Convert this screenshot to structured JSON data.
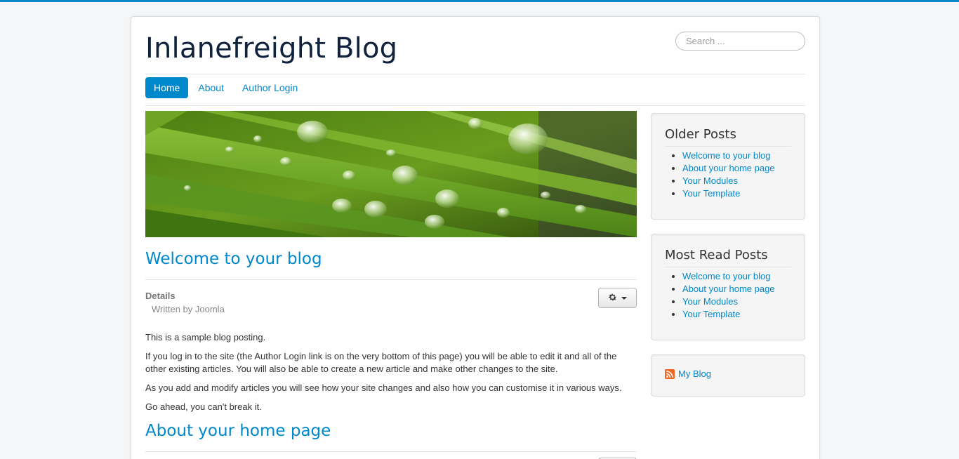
{
  "site": {
    "title": "Inlanefreight Blog",
    "search_placeholder": "Search ..."
  },
  "nav": {
    "items": [
      {
        "label": "Home",
        "active": true
      },
      {
        "label": "About",
        "active": false
      },
      {
        "label": "Author Login",
        "active": false
      }
    ]
  },
  "banner": {
    "icon": "dewdrop-grass-image"
  },
  "articles": [
    {
      "title": "Welcome to your blog",
      "details_label": "Details",
      "written_by": "Written by Joomla",
      "tools_icon": "gear-icon",
      "paragraphs": [
        "This is a sample blog posting.",
        "If you log in to the site (the Author Login link is on the very bottom of this page) you will be able to edit it and all of the other existing articles. You will also be able to create a new article and make other changes to the site.",
        "As you add and modify articles you will see how your site changes and also how you can customise it in various ways.",
        "Go ahead, you can't break it."
      ]
    },
    {
      "title": "About your home page"
    }
  ],
  "sidebar": {
    "older_posts": {
      "title": "Older Posts",
      "items": [
        "Welcome to your blog",
        "About your home page",
        "Your Modules",
        "Your Template"
      ]
    },
    "most_read": {
      "title": "Most Read Posts",
      "items": [
        "Welcome to your blog",
        "About your home page",
        "Your Modules",
        "Your Template"
      ]
    },
    "feed": {
      "label": "My Blog",
      "icon": "rss-icon"
    }
  },
  "colors": {
    "accent": "#0088cc",
    "title": "#10223e",
    "background": "#f4f6f7"
  }
}
